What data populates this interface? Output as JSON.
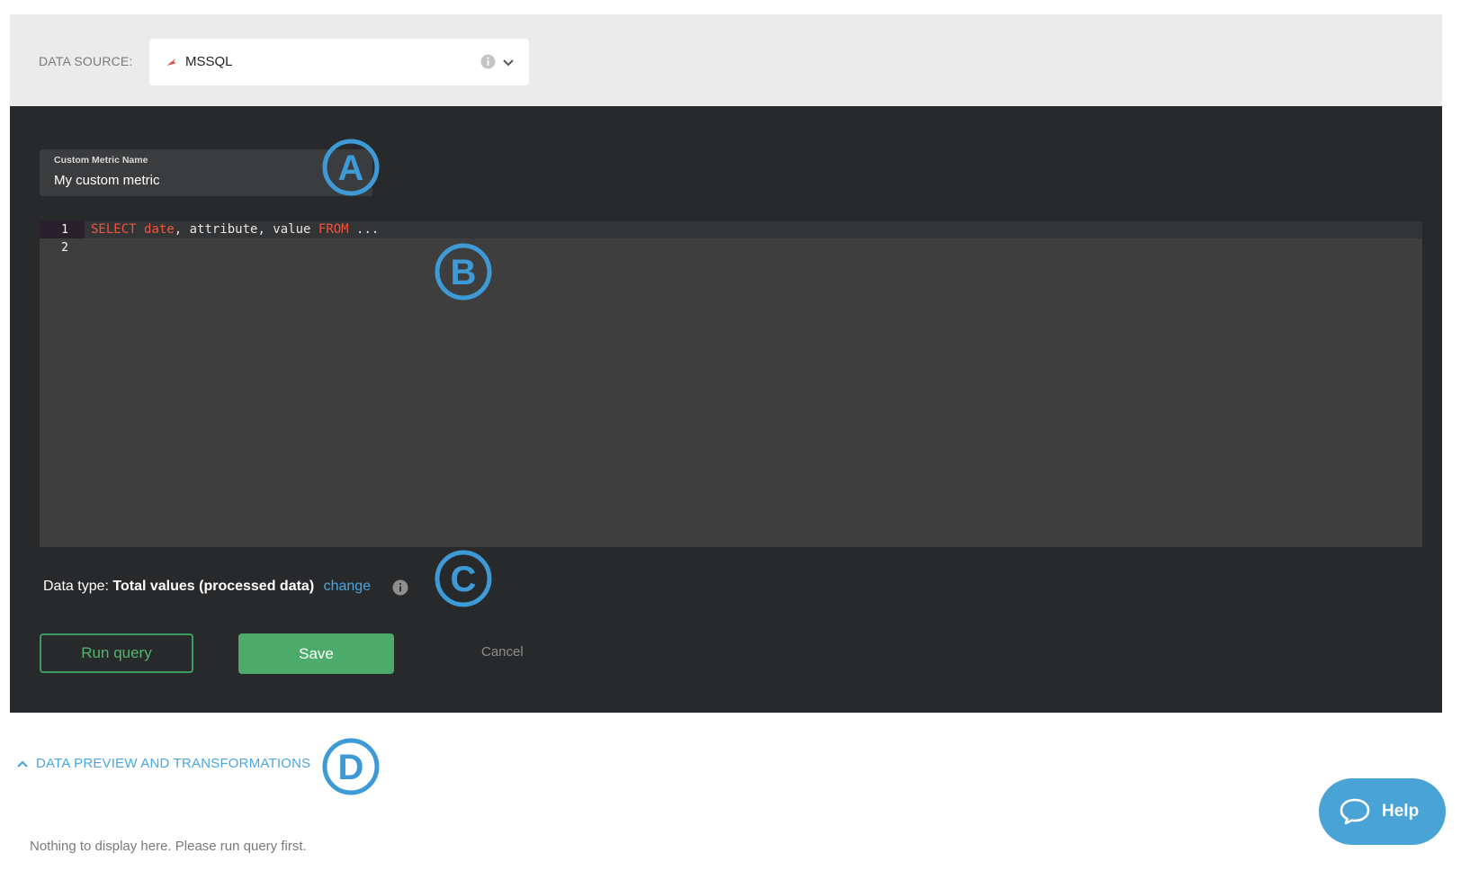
{
  "data_source": {
    "label": "DATA SOURCE:",
    "selected": "MSSQL",
    "icon": "mssql-db-icon"
  },
  "metric": {
    "field_label": "Custom Metric Name",
    "value": "My custom metric"
  },
  "editor": {
    "line_numbers": [
      "1",
      "2"
    ],
    "code": {
      "kw_select": "SELECT",
      "col_date": "date",
      "rest1": ", attribute, value ",
      "kw_from": "FROM",
      "rest2": " ..."
    }
  },
  "data_type": {
    "prefix": "Data type: ",
    "value": "Total values (processed data)",
    "change_link": "change"
  },
  "buttons": {
    "run": "Run query",
    "save": "Save",
    "cancel": "Cancel"
  },
  "markers": [
    "A",
    "B",
    "C",
    "D"
  ],
  "preview": {
    "toggle_label": "DATA PREVIEW AND TRANSFORMATIONS",
    "empty_message": "Nothing to display here. Please run query first."
  },
  "help": {
    "label": "Help"
  },
  "colors": {
    "accent_blue": "#4aa6e0",
    "green": "#4caa6a",
    "panel_dark": "#28292b",
    "keyword_red": "#f0543c"
  }
}
